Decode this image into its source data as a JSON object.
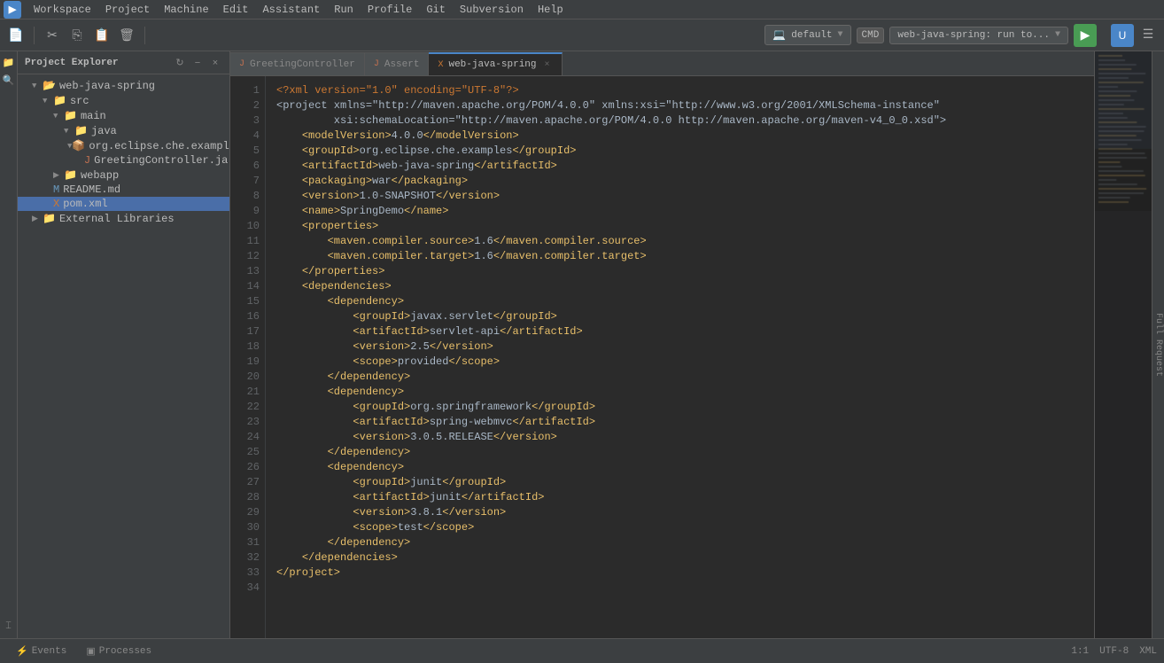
{
  "menubar": {
    "items": [
      "Workspace",
      "Project",
      "Machine",
      "Edit",
      "Assistant",
      "Run",
      "Profile",
      "Git",
      "Subversion",
      "Help"
    ]
  },
  "toolbar": {
    "run_config": {
      "type_label": "CMD",
      "config_name": "web-java-spring: run to...",
      "env_label": "default"
    }
  },
  "project_explorer": {
    "title": "Project Explorer",
    "root": "web-java-spring",
    "tree": [
      {
        "level": 1,
        "name": "web-java-spring",
        "type": "project",
        "expanded": true
      },
      {
        "level": 2,
        "name": "src",
        "type": "folder",
        "expanded": true
      },
      {
        "level": 3,
        "name": "main",
        "type": "folder",
        "expanded": true
      },
      {
        "level": 4,
        "name": "java",
        "type": "folder",
        "expanded": true
      },
      {
        "level": 5,
        "name": "org.eclipse.che.example...",
        "type": "package",
        "expanded": true
      },
      {
        "level": 6,
        "name": "GreetingController.ja...",
        "type": "java"
      },
      {
        "level": 3,
        "name": "webapp",
        "type": "folder"
      },
      {
        "level": 2,
        "name": "README.md",
        "type": "md"
      },
      {
        "level": 2,
        "name": "pom.xml",
        "type": "xml",
        "selected": true
      },
      {
        "level": 1,
        "name": "External Libraries",
        "type": "folder"
      }
    ]
  },
  "tabs": [
    {
      "label": "GreetingController",
      "type": "java",
      "active": false
    },
    {
      "label": "Assert",
      "type": "java",
      "active": false
    },
    {
      "label": "web-java-spring",
      "type": "xml",
      "active": true,
      "closeable": true
    }
  ],
  "code": {
    "lines": [
      {
        "n": 1,
        "text": "<?xml version=\"1.0\" encoding=\"UTF-8\"?>"
      },
      {
        "n": 2,
        "text": "<project xmlns=\"http://maven.apache.org/POM/4.0.0\" xmlns:xsi=\"http://www.w3.org/2001/XMLSchema-instance\""
      },
      {
        "n": 3,
        "text": "         xsi:schemaLocation=\"http://maven.apache.org/POM/4.0.0 http://maven.apache.org/maven-v4_0_0.xsd\">"
      },
      {
        "n": 4,
        "text": "    <modelVersion>4.0.0</modelVersion>"
      },
      {
        "n": 5,
        "text": "    <groupId>org.eclipse.che.examples</groupId>"
      },
      {
        "n": 6,
        "text": "    <artifactId>web-java-spring</artifactId>"
      },
      {
        "n": 7,
        "text": "    <packaging>war</packaging>"
      },
      {
        "n": 8,
        "text": "    <version>1.0-SNAPSHOT</version>"
      },
      {
        "n": 9,
        "text": "    <name>SpringDemo</name>"
      },
      {
        "n": 10,
        "text": "    <properties>"
      },
      {
        "n": 11,
        "text": "        <maven.compiler.source>1.6</maven.compiler.source>"
      },
      {
        "n": 12,
        "text": "        <maven.compiler.target>1.6</maven.compiler.target>"
      },
      {
        "n": 13,
        "text": "    </properties>"
      },
      {
        "n": 14,
        "text": "    <dependencies>"
      },
      {
        "n": 15,
        "text": "        <dependency>"
      },
      {
        "n": 16,
        "text": "            <groupId>javax.servlet</groupId>"
      },
      {
        "n": 17,
        "text": "            <artifactId>servlet-api</artifactId>"
      },
      {
        "n": 18,
        "text": "            <version>2.5</version>"
      },
      {
        "n": 19,
        "text": "            <scope>provided</scope>"
      },
      {
        "n": 20,
        "text": "        </dependency>"
      },
      {
        "n": 21,
        "text": "        <dependency>"
      },
      {
        "n": 22,
        "text": "            <groupId>org.springframework</groupId>"
      },
      {
        "n": 23,
        "text": "            <artifactId>spring-webmvc</artifactId>"
      },
      {
        "n": 24,
        "text": "            <version>3.0.5.RELEASE</version>"
      },
      {
        "n": 25,
        "text": "        </dependency>"
      },
      {
        "n": 26,
        "text": "        <dependency>"
      },
      {
        "n": 27,
        "text": "            <groupId>junit</groupId>"
      },
      {
        "n": 28,
        "text": "            <artifactId>junit</artifactId>"
      },
      {
        "n": 29,
        "text": "            <version>3.8.1</version>"
      },
      {
        "n": 30,
        "text": "            <scope>test</scope>"
      },
      {
        "n": 31,
        "text": "        </dependency>"
      },
      {
        "n": 32,
        "text": "    </dependencies>"
      },
      {
        "n": 33,
        "text": "</project>"
      },
      {
        "n": 34,
        "text": ""
      }
    ]
  },
  "status_bar": {
    "position": "1:1",
    "encoding": "UTF-8",
    "file_type": "XML"
  },
  "footer": {
    "tabs": [
      "Events",
      "Processes"
    ],
    "right_panel_label": "Full Request"
  }
}
